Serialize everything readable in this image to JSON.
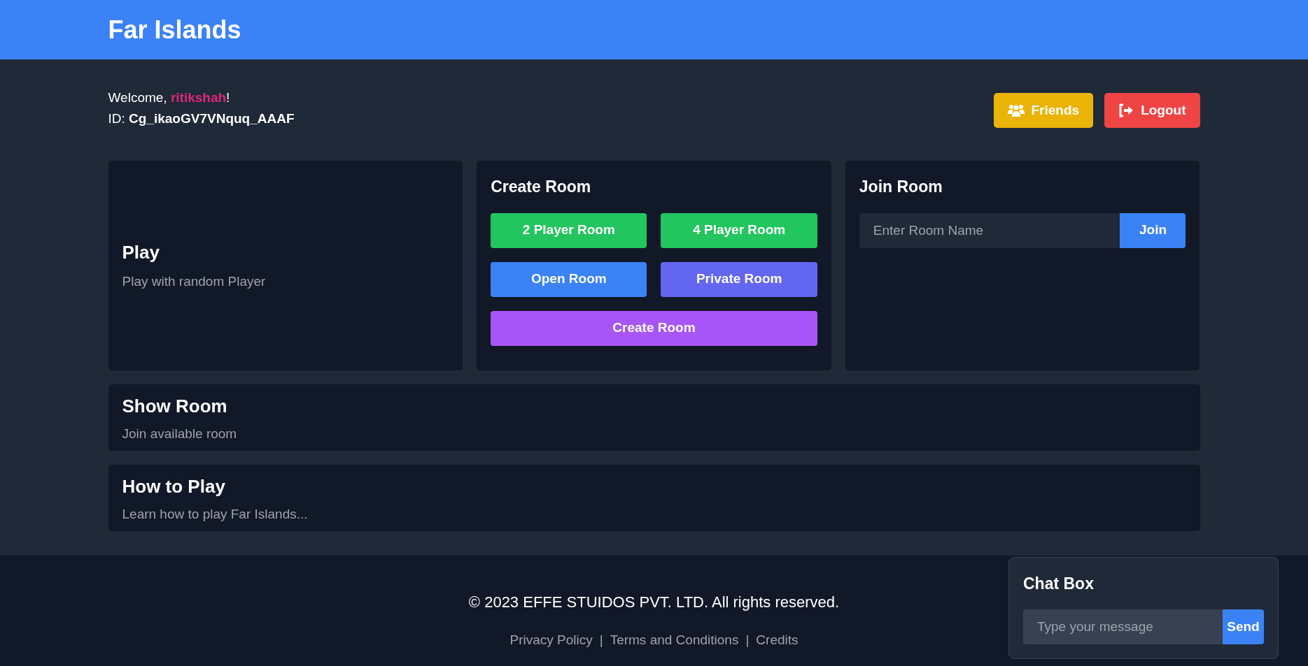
{
  "header": {
    "title": "Far Islands"
  },
  "user": {
    "welcome": "Welcome, **ritikshah**!",
    "id_line": "ID: **Cg_ikaoGV7VNquq_AAAF**"
  },
  "top_buttons": [
    {
      "label": "Friends",
      "kind": "friends"
    },
    {
      "label": "Logout",
      "kind": "logout"
    }
  ],
  "play_card": {
    "title": "Play",
    "subtitle": "Play with random Player"
  },
  "create_room": {
    "title": "Create Room",
    "buttons": [
      {
        "label": "2 Player Room",
        "color": "#22c55e"
      },
      {
        "label": "4 Player Room",
        "color": "#22c55e"
      },
      {
        "label": "Open Room",
        "color": "#3b82f6"
      },
      {
        "label": "Private Room",
        "color": "#6366f1"
      },
      {
        "label": "Create Room",
        "color": "#a855f7"
      }
    ]
  },
  "join_room": {
    "title": "Join Room",
    "placeholder": "Enter Room Name",
    "button": "Join"
  },
  "info_cards": [
    {
      "title": "Show Room",
      "subtitle": "Join available room"
    },
    {
      "title": "How to Play",
      "subtitle": "Learn how to play Far Islands..."
    }
  ],
  "footer": {
    "copyright": "© 2023 EFFE STUIDOS PVT. LTD. All rights reserved.",
    "links": [
      "Privacy Policy",
      "Terms and Conditions",
      "Credits"
    ],
    "separator": "|"
  },
  "chat": {
    "title": "Chat Box",
    "placeholder": "Type your message",
    "button": "Send"
  }
}
